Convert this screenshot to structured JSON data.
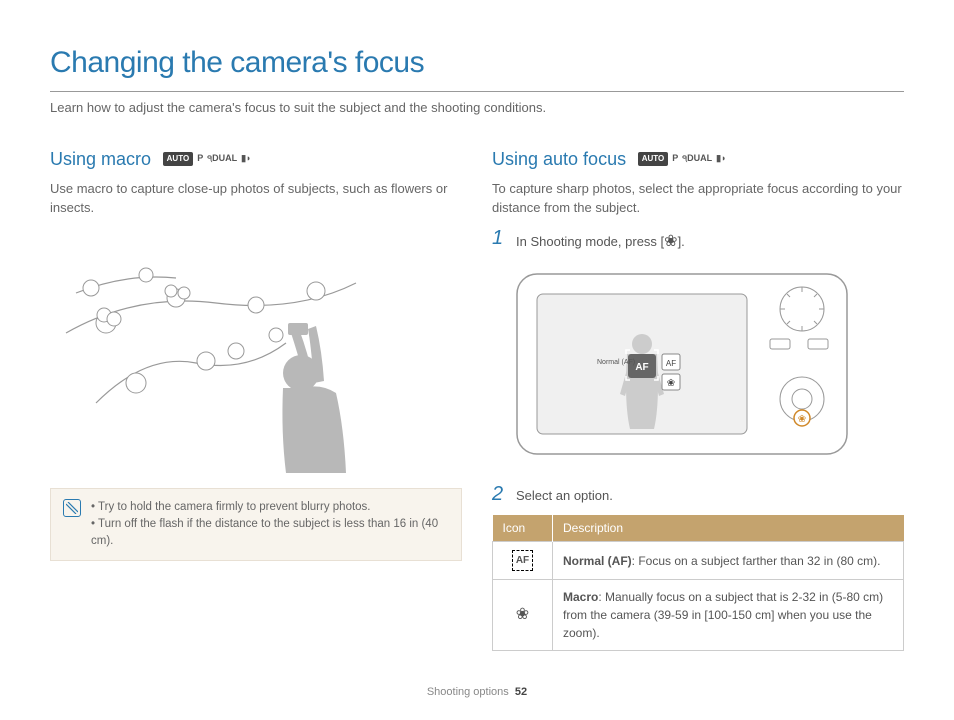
{
  "title": "Changing the camera's focus",
  "intro": "Learn how to adjust the camera's focus to suit the subject and the shooting conditions.",
  "left": {
    "heading": "Using macro",
    "modes": {
      "auto": "AUTO",
      "p": "P",
      "dual": "DUAL"
    },
    "desc": "Use macro to capture close-up photos of subjects, such as flowers or insects.",
    "tips": [
      "Try to hold the camera firmly to prevent blurry photos.",
      "Turn off the flash if the distance to the subject is less than 16 in (40 cm)."
    ]
  },
  "right": {
    "heading": "Using auto focus",
    "modes": {
      "auto": "AUTO",
      "p": "P",
      "dual": "DUAL"
    },
    "desc": "To capture sharp photos, select the appropriate focus according to your distance from the subject.",
    "step1_prefix": "In Shooting mode, press [",
    "step1_suffix": "].",
    "camera_label": "Normal (AF)",
    "step2": "Select an option.",
    "table": {
      "head_icon": "Icon",
      "head_desc": "Description",
      "rows": [
        {
          "icon_label": "AF",
          "bold": "Normal (AF)",
          "rest": ": Focus on a subject farther than 32 in (80 cm)."
        },
        {
          "icon_label": "flower",
          "bold": "Macro",
          "rest": ": Manually focus on a subject that is 2-32 in (5-80 cm) from the camera (39-59 in [100-150 cm] when you use the zoom)."
        }
      ]
    }
  },
  "footer": {
    "section": "Shooting options",
    "page": "52"
  }
}
